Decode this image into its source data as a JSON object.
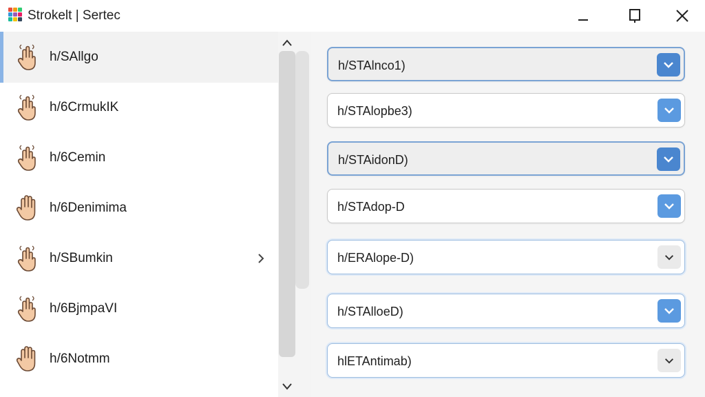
{
  "window": {
    "title": "Strokelt | Sertec",
    "logo_colors": [
      "#e74c3c",
      "#f39c12",
      "#2ecc71",
      "#3498db",
      "#9b59b6",
      "#e91e63",
      "#1abc9c",
      "#f1c40f",
      "#34495e"
    ]
  },
  "left_list": {
    "items": [
      {
        "label": "h/SAllgo",
        "icon": "hand-pinch-icon",
        "selected": true
      },
      {
        "label": "h/6CrmukIK",
        "icon": "hand-pinch-icon"
      },
      {
        "label": "h/6Cemin",
        "icon": "hand-pinch-icon"
      },
      {
        "label": "h/6Denimima",
        "icon": "open-hand-icon"
      },
      {
        "label": "h/SBumkin",
        "icon": "hand-pinch-icon",
        "has_chevron": true
      },
      {
        "label": "h/6BjmpaVI",
        "icon": "hand-pinch-icon"
      },
      {
        "label": "h/6Notmm",
        "icon": "open-hand-icon"
      }
    ]
  },
  "dropdowns": [
    {
      "value": "h/STAlnco1)",
      "button": "blue"
    },
    {
      "value": "h/STAlopbe3)",
      "button": "blue"
    },
    {
      "value": "h/STAidonD)",
      "button": "blue"
    },
    {
      "value": "h/STAdop-D",
      "button": "blue"
    },
    {
      "value": "h/ERAlope-D)",
      "button": "grey"
    },
    {
      "value": "h/STAlloeD)",
      "button": "blue"
    },
    {
      "value": "hlETAntimab)",
      "button": "grey"
    }
  ],
  "colors": {
    "accent": "#5b9ae0",
    "selection_bar": "#8ab4e6"
  }
}
